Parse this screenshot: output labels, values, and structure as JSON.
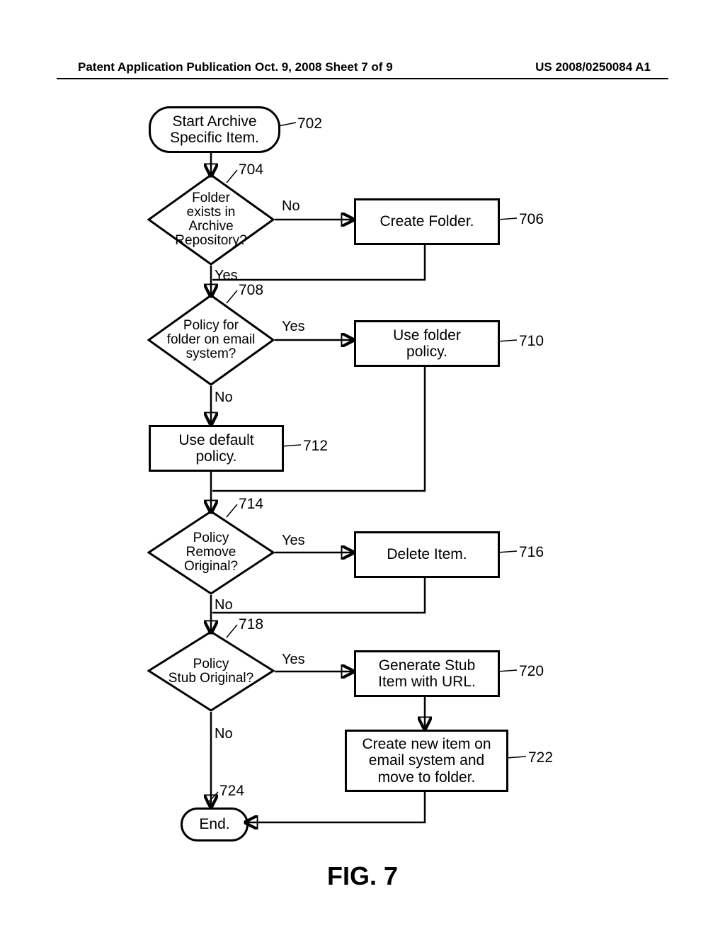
{
  "header": {
    "left": "Patent Application Publication",
    "mid": "Oct. 9, 2008  Sheet 7 of 9",
    "right": "US 2008/0250084 A1"
  },
  "figcap": "FIG. 7",
  "shapes": {
    "start": "Start Archive\nSpecific Item.",
    "d704": "Folder\nexists in Archive\nRepository?",
    "p706": "Create Folder.",
    "d708": "Policy for\nfolder on email\nsystem?",
    "p710": "Use folder\npolicy.",
    "p712": "Use default\npolicy.",
    "d714": "Policy\nRemove\nOriginal?",
    "p716": "Delete Item.",
    "d718": "Policy\nStub Original?",
    "p720": "Generate Stub\nItem with URL.",
    "p722": "Create new item on\nemail system and\nmove to folder.",
    "end": "End."
  },
  "refs": {
    "r702": "702",
    "r704": "704",
    "r706": "706",
    "r708": "708",
    "r710": "710",
    "r712": "712",
    "r714": "714",
    "r716": "716",
    "r718": "718",
    "r720": "720",
    "r722": "722",
    "r724": "724"
  },
  "yn": {
    "no": "No",
    "yes": "Yes"
  }
}
